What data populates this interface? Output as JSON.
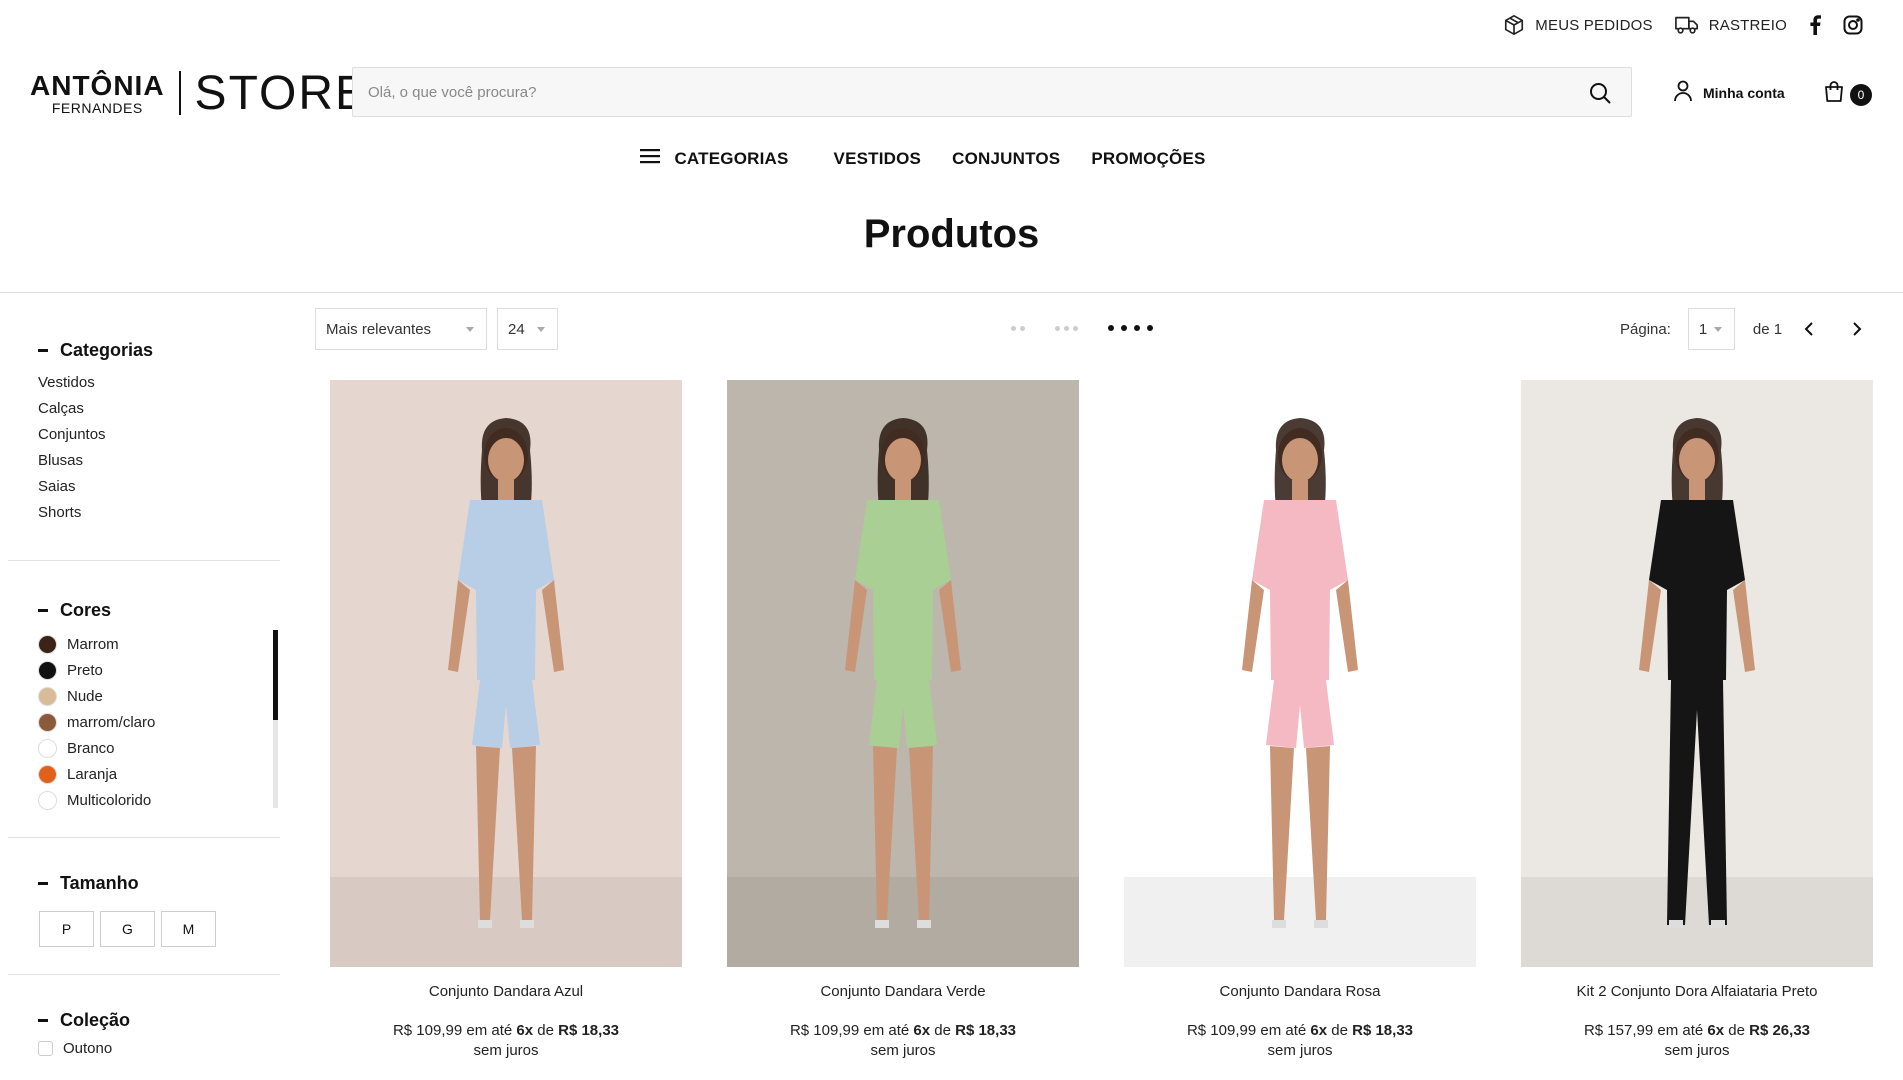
{
  "topbar": {
    "orders": "MEUS PEDIDOS",
    "tracking": "RASTREIO"
  },
  "logo": {
    "line1": "ANTÔNIA",
    "line2": "FERNANDES",
    "store": "STORE"
  },
  "search": {
    "placeholder": "Olá, o que você procura?"
  },
  "account": {
    "label": "Minha conta"
  },
  "cart": {
    "count": "0"
  },
  "nav": {
    "categories": "CATEGORIAS",
    "items": [
      "VESTIDOS",
      "CONJUNTOS",
      "PROMOÇÕES"
    ]
  },
  "page_title": "Produtos",
  "toolbar": {
    "sort": "Mais relevantes",
    "per_page": "24",
    "page_label": "Página:",
    "page_value": "1",
    "page_of": "de 1"
  },
  "filters": {
    "categories": {
      "title": "Categorias",
      "items": [
        "Vestidos",
        "Calças",
        "Conjuntos",
        "Blusas",
        "Saias",
        "Shorts"
      ]
    },
    "colors": {
      "title": "Cores",
      "items": [
        {
          "label": "Marrom",
          "color": "#3b2318"
        },
        {
          "label": "Preto",
          "color": "#111111"
        },
        {
          "label": "Nude",
          "color": "#d8bc98"
        },
        {
          "label": "marrom/claro",
          "color": "#8b5a3c"
        },
        {
          "label": "Branco",
          "color": "#ffffff"
        },
        {
          "label": "Laranja",
          "color": "#e0601c"
        },
        {
          "label": "Multicolorido",
          "color": "#ffffff"
        }
      ]
    },
    "sizes": {
      "title": "Tamanho",
      "items": [
        "P",
        "G",
        "M"
      ]
    },
    "collection": {
      "title": "Coleção",
      "items": [
        "Outono"
      ]
    }
  },
  "products": [
    {
      "name": "Conjunto Dandara Azul",
      "price": "R$ 109,99",
      "installment_pre": "em até",
      "installments": "6x",
      "of": "de",
      "installment_value": "R$ 18,33",
      "juros": "sem juros",
      "outfit_color": "#b8cde6",
      "bg_color": "#e6d6d0"
    },
    {
      "name": "Conjunto Dandara Verde",
      "price": "R$ 109,99",
      "installment_pre": "em até",
      "installments": "6x",
      "of": "de",
      "installment_value": "R$ 18,33",
      "juros": "sem juros",
      "outfit_color": "#a9cf95",
      "bg_color": "#bdb6ad"
    },
    {
      "name": "Conjunto Dandara Rosa",
      "price": "R$ 109,99",
      "installment_pre": "em até",
      "installments": "6x",
      "of": "de",
      "installment_value": "R$ 18,33",
      "juros": "sem juros",
      "outfit_color": "#f4b9c2",
      "bg_color": "#ffffff"
    },
    {
      "name": "Kit 2 Conjunto Dora Alfaiataria Preto",
      "price": "R$ 157,99",
      "installment_pre": "em até",
      "installments": "6x",
      "of": "de",
      "installment_value": "R$ 26,33",
      "juros": "sem juros",
      "outfit_color": "#151515",
      "bg_color": "#ebe7e3"
    }
  ]
}
